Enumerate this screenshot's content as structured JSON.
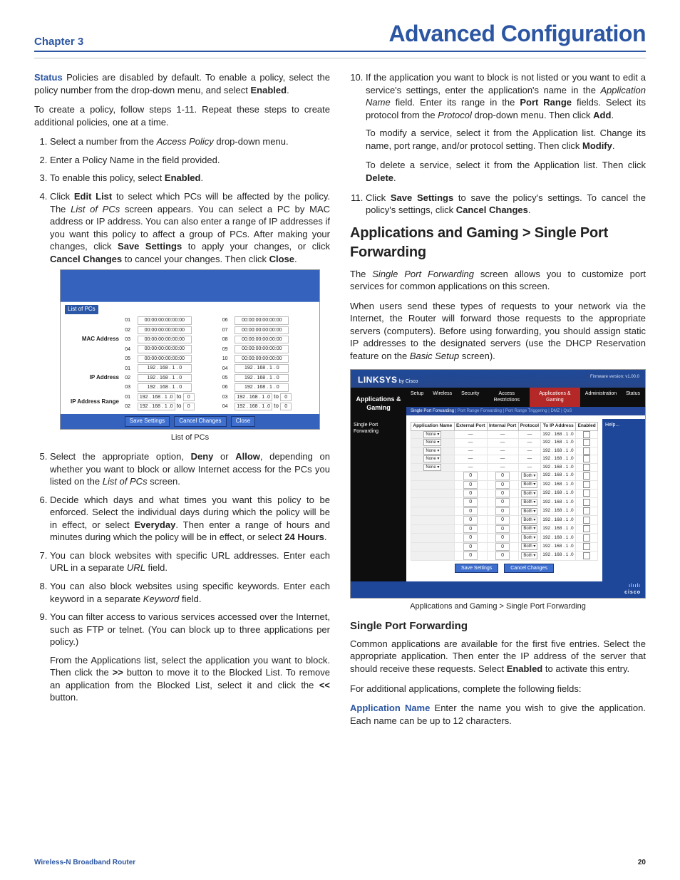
{
  "header": {
    "chapter": "Chapter 3",
    "title": "Advanced Configuration"
  },
  "left": {
    "status_lead": "Status",
    "status_body": "  Policies are disabled by default. To enable a policy, select the policy number from the drop-down menu, and select ",
    "status_enabled": "Enabled",
    "create_policy": "To create a policy, follow steps 1-11. Repeat these steps to create additional policies, one at a time.",
    "s1a": "Select a number from the ",
    "s1b": "Access Policy",
    "s1c": " drop-down menu.",
    "s2": "Enter a Policy Name in the field provided.",
    "s3a": "To enable this policy, select ",
    "s3b": "Enabled",
    "s4a": "Click ",
    "s4b": "Edit List",
    "s4c": " to select which PCs will be affected by the policy. The ",
    "s4d": "List of PCs",
    "s4e": " screen appears. You can select a PC by MAC address or IP address. You can also enter a range of IP addresses if you want this policy to affect a group of PCs. After making your changes, click ",
    "s4f": "Save Settings",
    "s4g": " to apply your changes, or click ",
    "s4h": "Cancel Changes",
    "s4i": " to cancel your changes. Then click ",
    "s4j": "Close",
    "fig1": {
      "listpc_bar": "List of PCs",
      "mac_label": "MAC Address",
      "ip_label": "IP Address",
      "iprange_label": "IP Address Range",
      "mac_placeholder": "00:00:00:00:00:00",
      "ip_base": "192 . 168 . 1 .",
      "zero": "0",
      "to": "to",
      "save": "Save Settings",
      "cancel": "Cancel Changes",
      "close": "Close",
      "caption": "List of PCs",
      "mac_nums_l": [
        "01",
        "02",
        "03",
        "04",
        "05"
      ],
      "mac_nums_r": [
        "06",
        "07",
        "08",
        "09",
        "10"
      ],
      "ip_nums_l": [
        "01",
        "02",
        "03"
      ],
      "ip_nums_r": [
        "04",
        "05",
        "06"
      ],
      "ipr_nums_l": [
        "01",
        "02"
      ],
      "ipr_nums_r": [
        "03",
        "04"
      ]
    },
    "s5a": "Select the appropriate option, ",
    "s5b": "Deny",
    "s5c": " or ",
    "s5d": "Allow",
    "s5e": ", depending on whether you want to block or allow Internet access for the PCs you listed on the ",
    "s5f": "List of PCs",
    "s5g": " screen.",
    "s6a": "Decide which days and what times you want this policy to be enforced. Select the individual days during which the policy will be in effect, or select ",
    "s6b": "Everyday",
    "s6c": ". Then enter a range of hours and minutes during which the policy will be in effect, or select ",
    "s6d": "24 Hours",
    "s7a": "You can block websites with specific URL addresses. Enter each URL in a separate ",
    "s7b": "URL",
    "s7c": " field.",
    "s8a": "You can also block websites using specific keywords. Enter each keyword in a separate ",
    "s8b": "Keyword",
    "s8c": " field.",
    "s9a": "You can filter access to various services accessed over the Internet, such as FTP or telnet. (You can block up to three applications per policy.)",
    "s9b": "From the Applications list, select the application you want to block. Then click the ",
    "s9c": ">>",
    "s9d": " button to move it to the Blocked List. To remove an application from the Blocked List, select it and click the ",
    "s9e": "<<",
    "s9f": " button."
  },
  "right": {
    "s10a": "If the application you want to block is not listed or you want to edit a service's settings, enter the application's name in the ",
    "s10b": "Application Name",
    "s10c": " field. Enter its range in the ",
    "s10d": "Port Range",
    "s10e": " fields. Select its protocol from the ",
    "s10f": "Protocol",
    "s10g": " drop-down menu. Then click ",
    "s10h": "Add",
    "s10mod_a": "To modify a service, select it from the Application list. Change its name, port range, and/or protocol setting. Then click ",
    "s10mod_b": "Modify",
    "s10del_a": "To delete a service, select it from the Application list. Then click ",
    "s10del_b": "Delete",
    "s11a": "Click ",
    "s11b": "Save Settings",
    "s11c": " to save the policy's settings. To cancel the policy's settings, click ",
    "s11d": "Cancel Changes",
    "h2": "Applications and Gaming > Single Port Forwarding",
    "p1a": "The ",
    "p1b": "Single Port Forwarding",
    "p1c": " screen allows you to customize port services for common applications on this screen.",
    "p2a": "When users send these types of requests to your network via the Internet, the Router will forward those requests to the appropriate servers (computers). Before using forwarding, you should assign static IP addresses to the designated servers (use the DHCP Reservation feature on the ",
    "p2b": "Basic Setup",
    "p2c": " screen).",
    "fig2": {
      "brand": "LINKSYS",
      "by": "by Cisco",
      "fw": "Firmware version: v1.00.0",
      "left_title": "Applications & Gaming",
      "tabs": [
        "Setup",
        "Wireless",
        "Security",
        "Access Restrictions",
        "Applications & Gaming",
        "Administration",
        "Status"
      ],
      "subtabs_on": "Single Port Forwarding",
      "subtabs_rest": "   |   Port Range Forwarding   |   Port Range Triggering   |   DMZ   |   QoS",
      "side": "Single Port Forwarding",
      "help": "Help...",
      "th": [
        "Application Name",
        "External Port",
        "Internal Port",
        "Protocol",
        "To IP Address",
        "Enabled"
      ],
      "none": "None",
      "dash": "—",
      "both": "Both",
      "ipbase": "192 . 168 . 1 .",
      "zero": "0",
      "save": "Save Settings",
      "cancel": "Cancel Changes",
      "cisco": "cisco",
      "cisco_tag": "ılıılı",
      "caption": "Applications and Gaming > Single Port Forwarding"
    },
    "h3": "Single Port Forwarding",
    "p3a": "Common applications are available for the first five entries. Select the appropriate application. Then enter the IP address of the server that should receive these requests. Select ",
    "p3b": "Enabled",
    "p3c": " to activate this entry.",
    "p4": "For additional applications, complete the following fields:",
    "p5_lead": "Application Name",
    "p5_body": "  Enter the name you wish to give the application. Each name can be up to 12 characters."
  },
  "footer": {
    "product": "Wireless-N Broadband Router",
    "page": "20"
  }
}
